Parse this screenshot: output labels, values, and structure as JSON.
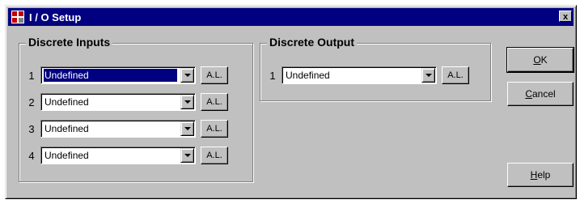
{
  "window": {
    "title": "I / O Setup",
    "close_glyph": "x",
    "icon": "app-grid-icon"
  },
  "discrete_inputs": {
    "label": "Discrete Inputs",
    "rows": [
      {
        "num": "1",
        "value": "Undefined",
        "button": "A.L."
      },
      {
        "num": "2",
        "value": "Undefined",
        "button": "A.L."
      },
      {
        "num": "3",
        "value": "Undefined",
        "button": "A.L."
      },
      {
        "num": "4",
        "value": "Undefined",
        "button": "A.L."
      }
    ]
  },
  "discrete_output": {
    "label": "Discrete Output",
    "rows": [
      {
        "num": "1",
        "value": "Undefined",
        "button": "A.L."
      }
    ]
  },
  "buttons": {
    "ok": {
      "mnemonic": "O",
      "rest": "K"
    },
    "cancel": {
      "mnemonic": "C",
      "rest": "ancel"
    },
    "help": {
      "mnemonic": "H",
      "rest": "elp"
    }
  },
  "colors": {
    "titlebar": "#000080",
    "face": "#c0c0c0",
    "selection": "#000080"
  }
}
